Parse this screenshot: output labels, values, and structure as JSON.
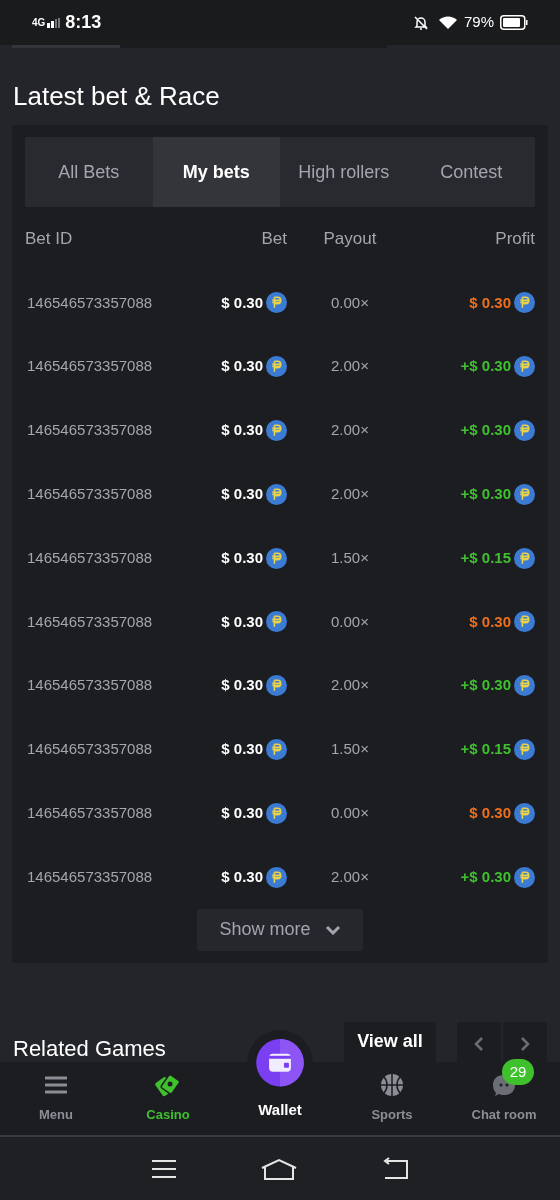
{
  "status_bar": {
    "network": "4G",
    "time": "8:13",
    "battery": "79%"
  },
  "section_title": "Latest bet & Race",
  "tabs": [
    {
      "label": "All Bets",
      "selected": false
    },
    {
      "label": "My bets",
      "selected": true
    },
    {
      "label": "High rollers",
      "selected": false
    },
    {
      "label": "Contest",
      "selected": false
    }
  ],
  "table": {
    "columns": [
      "Bet ID",
      "Bet",
      "Payout",
      "Profit"
    ],
    "rows": [
      {
        "bet_id": "146546573357088",
        "bet": "$ 0.30",
        "payout": "0.00×",
        "profit": "$ 0.30",
        "kind": "loss"
      },
      {
        "bet_id": "146546573357088",
        "bet": "$ 0.30",
        "payout": "2.00×",
        "profit": "+$ 0.30",
        "kind": "win"
      },
      {
        "bet_id": "146546573357088",
        "bet": "$ 0.30",
        "payout": "2.00×",
        "profit": "+$ 0.30",
        "kind": "win"
      },
      {
        "bet_id": "146546573357088",
        "bet": "$ 0.30",
        "payout": "2.00×",
        "profit": "+$ 0.30",
        "kind": "win"
      },
      {
        "bet_id": "146546573357088",
        "bet": "$ 0.30",
        "payout": "1.50×",
        "profit": "+$ 0.15",
        "kind": "win"
      },
      {
        "bet_id": "146546573357088",
        "bet": "$ 0.30",
        "payout": "0.00×",
        "profit": "$ 0.30",
        "kind": "loss"
      },
      {
        "bet_id": "146546573357088",
        "bet": "$ 0.30",
        "payout": "2.00×",
        "profit": "+$ 0.30",
        "kind": "win"
      },
      {
        "bet_id": "146546573357088",
        "bet": "$ 0.30",
        "payout": "1.50×",
        "profit": "+$ 0.15",
        "kind": "win"
      },
      {
        "bet_id": "146546573357088",
        "bet": "$ 0.30",
        "payout": "0.00×",
        "profit": "$ 0.30",
        "kind": "loss"
      },
      {
        "bet_id": "146546573357088",
        "bet": "$ 0.30",
        "payout": "2.00×",
        "profit": "+$ 0.30",
        "kind": "win"
      }
    ],
    "show_more": "Show more"
  },
  "related": {
    "title": "Related Games",
    "view_all": "View all"
  },
  "bottom_nav": [
    {
      "label": "Menu",
      "kind": "menu",
      "selected": false
    },
    {
      "label": "Casino",
      "kind": "casino",
      "selected": true
    },
    {
      "label": "Wallet",
      "kind": "wallet",
      "selected": false
    },
    {
      "label": "Sports",
      "kind": "sports",
      "selected": false
    },
    {
      "label": "Chat room",
      "kind": "chat",
      "selected": false,
      "badge": "29"
    }
  ]
}
